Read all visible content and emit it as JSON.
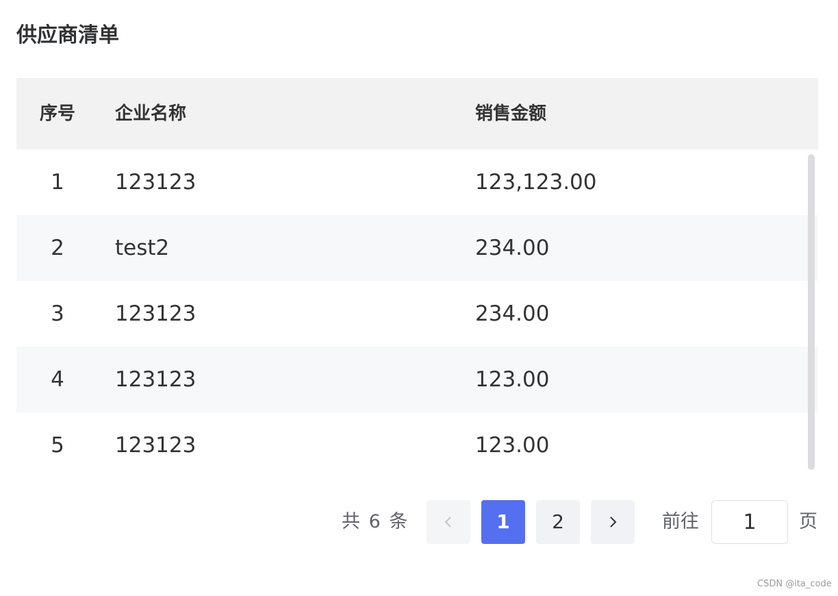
{
  "title": "供应商清单",
  "table": {
    "columns": [
      "序号",
      "企业名称",
      "销售金额"
    ],
    "rows": [
      {
        "index": "1",
        "name": "123123",
        "amount": "123,123.00"
      },
      {
        "index": "2",
        "name": "test2",
        "amount": "234.00"
      },
      {
        "index": "3",
        "name": "123123",
        "amount": "234.00"
      },
      {
        "index": "4",
        "name": "123123",
        "amount": "123.00"
      },
      {
        "index": "5",
        "name": "123123",
        "amount": "123.00"
      }
    ]
  },
  "pagination": {
    "total_text": "共 6 条",
    "pages": [
      "1",
      "2"
    ],
    "current_page": "1",
    "prev_icon": "chevron-left-icon",
    "next_icon": "chevron-right-icon",
    "goto_label": "前往",
    "goto_value": "1",
    "page_suffix": "页"
  },
  "watermark": "CSDN @ita_code",
  "colors": {
    "accent": "#5470f0",
    "header_bg": "#f2f2f2",
    "stripe_bg": "#f7f8fa"
  }
}
